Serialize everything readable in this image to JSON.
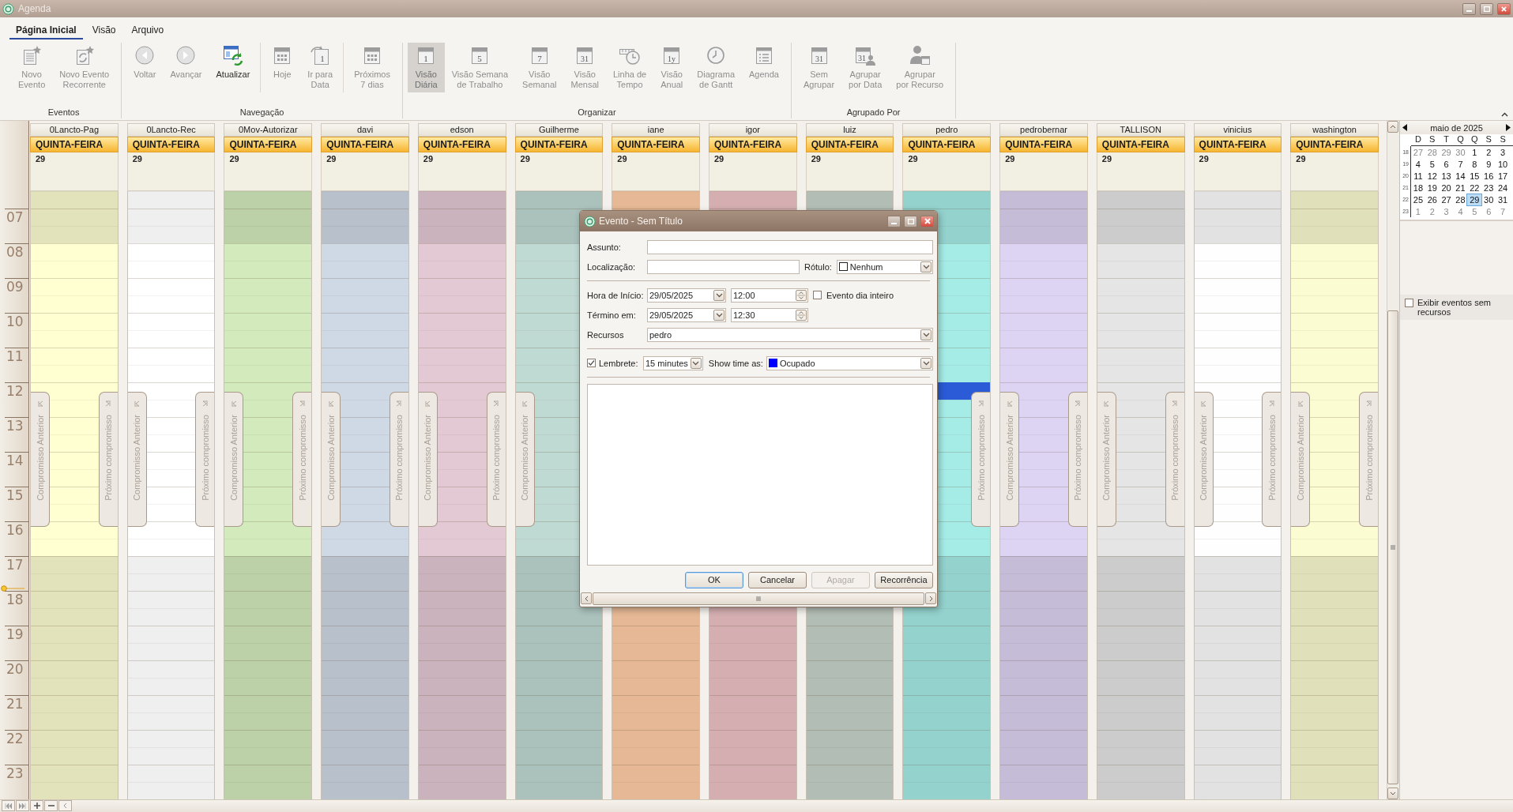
{
  "window": {
    "title": "Agenda"
  },
  "ribbon": {
    "tabs": [
      {
        "label": "Página Inicial",
        "selected": true
      },
      {
        "label": "Visão",
        "selected": false
      },
      {
        "label": "Arquivo",
        "selected": false
      }
    ],
    "groups": [
      {
        "label": "Eventos",
        "sections": [
          [
            {
              "label": "Novo\nEvento",
              "kind": "new-doc",
              "disabled": true,
              "selected": false
            },
            {
              "label": "Novo Evento\nRecorrente",
              "kind": "recur-doc",
              "disabled": true,
              "selected": false
            }
          ]
        ]
      },
      {
        "label": "Navegação",
        "sections": [
          [
            {
              "label": "Voltar",
              "kind": "back",
              "disabled": true,
              "selected": false
            },
            {
              "label": "Avançar",
              "kind": "forward",
              "disabled": true,
              "selected": false
            },
            {
              "label": "Atualizar",
              "kind": "refresh",
              "disabled": false,
              "selected": false
            }
          ],
          [
            {
              "label": "Hoje",
              "kind": "grid-cal",
              "disabled": true,
              "selected": false
            },
            {
              "label": "Ir para\nData",
              "kind": "page-arrow",
              "icon_text": "1",
              "disabled": true,
              "selected": false
            }
          ],
          [
            {
              "label": "Próximos\n7 dias",
              "kind": "grid-cal",
              "disabled": true,
              "selected": false
            }
          ]
        ]
      },
      {
        "label": "Organizar",
        "sections": [
          [
            {
              "label": "Visão\nDiária",
              "kind": "calendar",
              "icon_text": "1",
              "disabled": true,
              "selected": true
            },
            {
              "label": "Visão Semana\nde Trabalho",
              "kind": "calendar",
              "icon_text": "5",
              "disabled": true,
              "selected": false
            },
            {
              "label": "Visão\nSemanal",
              "kind": "calendar",
              "icon_text": "7",
              "disabled": true,
              "selected": false
            },
            {
              "label": "Visão\nMensal",
              "kind": "calendar",
              "icon_text": "31",
              "disabled": true,
              "selected": false
            },
            {
              "label": "Linha de\nTempo",
              "kind": "timeline",
              "disabled": true,
              "selected": false
            },
            {
              "label": "Visão\nAnual",
              "kind": "calendar",
              "icon_text": "1y",
              "disabled": true,
              "selected": false
            },
            {
              "label": "Diagrama\nde Gantt",
              "kind": "clock",
              "disabled": true,
              "selected": false
            },
            {
              "label": "Agenda",
              "kind": "list",
              "disabled": true,
              "selected": false
            }
          ]
        ]
      },
      {
        "label": "Agrupado Por",
        "sections": [
          [
            {
              "label": "Sem\nAgrupar",
              "kind": "calendar",
              "icon_text": "31",
              "disabled": true,
              "selected": false
            },
            {
              "label": "Agrupar\npor Data",
              "kind": "cal-person",
              "icon_text": "31",
              "disabled": true,
              "selected": false
            },
            {
              "label": "Agrupar\npor Recurso",
              "kind": "person-cal",
              "disabled": true,
              "selected": false
            }
          ]
        ]
      }
    ]
  },
  "time_labels": [
    "07",
    "08",
    "09",
    "10",
    "11",
    "12",
    "13",
    "14",
    "15",
    "16",
    "17",
    "18",
    "19",
    "20",
    "21",
    "22",
    "23"
  ],
  "columns": [
    {
      "name": "0Lancto-Pag",
      "day": "QUINTA-FEIRA",
      "date": "29",
      "color": "#e3e3bb",
      "prev_tab": "Compromisso Anterior",
      "next_tab": "Próximo compromisso",
      "slot_selected": false
    },
    {
      "name": "0Lancto-Rec",
      "day": "QUINTA-FEIRA",
      "date": "29",
      "color": "#efefef",
      "prev_tab": "Compromisso Anterior",
      "next_tab": "Próximo compromisso",
      "slot_selected": false
    },
    {
      "name": "0Mov-Autorizar",
      "day": "QUINTA-FEIRA",
      "date": "29",
      "color": "#bcd1a7",
      "prev_tab": "Compromisso Anterior",
      "next_tab": "Próximo compromisso",
      "slot_selected": false
    },
    {
      "name": "davi",
      "day": "QUINTA-FEIRA",
      "date": "29",
      "color": "#b8c0cc",
      "prev_tab": "Compromisso Anterior",
      "next_tab": "Próximo compromisso",
      "slot_selected": false
    },
    {
      "name": "edson",
      "day": "QUINTA-FEIRA",
      "date": "29",
      "color": "#cab3bc",
      "prev_tab": "Compromisso Anterior",
      "next_tab": "Próximo compromisso",
      "slot_selected": false
    },
    {
      "name": "Guilherme",
      "day": "QUINTA-FEIRA",
      "date": "29",
      "color": "#aac1bc",
      "prev_tab": "Compromisso Anterior",
      "slot_selected": false
    },
    {
      "name": "iane",
      "day": "QUINTA-FEIRA",
      "date": "29",
      "color": "#e6b895",
      "slot_selected": false
    },
    {
      "name": "igor",
      "day": "QUINTA-FEIRA",
      "date": "29",
      "color": "#d4aeb1",
      "slot_selected": false
    },
    {
      "name": "luiz",
      "day": "QUINTA-FEIRA",
      "date": "29",
      "color": "#b2bdb5",
      "slot_selected": false
    },
    {
      "name": "pedro",
      "day": "QUINTA-FEIRA",
      "date": "29",
      "color": "#94d2cd",
      "next_tab": "Próximo compromisso",
      "slot_selected": true
    },
    {
      "name": "pedrobernar",
      "day": "QUINTA-FEIRA",
      "date": "29",
      "color": "#c5bdd8",
      "prev_tab": "Compromisso Anterior",
      "next_tab": "Próximo compromisso",
      "slot_selected": false
    },
    {
      "name": "TALLISON",
      "day": "QUINTA-FEIRA",
      "date": "29",
      "color": "#cccccc",
      "prev_tab": "Compromisso Anterior",
      "next_tab": "Próximo compromisso",
      "slot_selected": false
    },
    {
      "name": "vinicius",
      "day": "QUINTA-FEIRA",
      "date": "29",
      "color": "#e2e2e2",
      "prev_tab": "Compromisso Anterior",
      "next_tab": "Próximo compromisso",
      "slot_selected": false
    },
    {
      "name": "washington",
      "day": "QUINTA-FEIRA",
      "date": "29",
      "color": "#e0e0bb",
      "prev_tab": "Compromisso Anterior",
      "next_tab": "Próximo compromisso",
      "slot_selected": false
    }
  ],
  "mini_calendar": {
    "title": "maio de 2025",
    "weekdays": [
      "D",
      "S",
      "T",
      "Q",
      "Q",
      "S",
      "S"
    ],
    "weeks": [
      {
        "number": "18",
        "days": [
          {
            "d": "27",
            "other": true,
            "selected": false
          },
          {
            "d": "28",
            "other": true,
            "selected": false
          },
          {
            "d": "29",
            "other": true,
            "selected": false
          },
          {
            "d": "30",
            "other": true,
            "selected": false
          },
          {
            "d": "1",
            "other": false,
            "selected": false
          },
          {
            "d": "2",
            "other": false,
            "selected": false
          },
          {
            "d": "3",
            "other": false,
            "selected": false
          }
        ]
      },
      {
        "number": "19",
        "days": [
          {
            "d": "4",
            "other": false,
            "selected": false
          },
          {
            "d": "5",
            "other": false,
            "selected": false
          },
          {
            "d": "6",
            "other": false,
            "selected": false
          },
          {
            "d": "7",
            "other": false,
            "selected": false
          },
          {
            "d": "8",
            "other": false,
            "selected": false
          },
          {
            "d": "9",
            "other": false,
            "selected": false
          },
          {
            "d": "10",
            "other": false,
            "selected": false
          }
        ]
      },
      {
        "number": "20",
        "days": [
          {
            "d": "11",
            "other": false,
            "selected": false
          },
          {
            "d": "12",
            "other": false,
            "selected": false
          },
          {
            "d": "13",
            "other": false,
            "selected": false
          },
          {
            "d": "14",
            "other": false,
            "selected": false
          },
          {
            "d": "15",
            "other": false,
            "selected": false
          },
          {
            "d": "16",
            "other": false,
            "selected": false
          },
          {
            "d": "17",
            "other": false,
            "selected": false
          }
        ]
      },
      {
        "number": "21",
        "days": [
          {
            "d": "18",
            "other": false,
            "selected": false
          },
          {
            "d": "19",
            "other": false,
            "selected": false
          },
          {
            "d": "20",
            "other": false,
            "selected": false
          },
          {
            "d": "21",
            "other": false,
            "selected": false
          },
          {
            "d": "22",
            "other": false,
            "selected": false
          },
          {
            "d": "23",
            "other": false,
            "selected": false
          },
          {
            "d": "24",
            "other": false,
            "selected": false
          }
        ]
      },
      {
        "number": "22",
        "days": [
          {
            "d": "25",
            "other": false,
            "selected": false
          },
          {
            "d": "26",
            "other": false,
            "selected": false
          },
          {
            "d": "27",
            "other": false,
            "selected": false
          },
          {
            "d": "28",
            "other": false,
            "selected": false
          },
          {
            "d": "29",
            "other": false,
            "selected": true
          },
          {
            "d": "30",
            "other": false,
            "selected": false
          },
          {
            "d": "31",
            "other": false,
            "selected": false
          }
        ]
      },
      {
        "number": "23",
        "days": [
          {
            "d": "1",
            "other": true,
            "selected": false
          },
          {
            "d": "2",
            "other": true,
            "selected": false
          },
          {
            "d": "3",
            "other": true,
            "selected": false
          },
          {
            "d": "4",
            "other": true,
            "selected": false
          },
          {
            "d": "5",
            "other": true,
            "selected": false
          },
          {
            "d": "6",
            "other": true,
            "selected": false
          },
          {
            "d": "7",
            "other": true,
            "selected": false
          }
        ]
      }
    ]
  },
  "unassigned_option": {
    "label": "Exibir eventos sem recursos",
    "checked": false
  },
  "dialog": {
    "title": "Evento - Sem Título",
    "subject": {
      "label": "Assunto:"
    },
    "location": {
      "label": "Localização:"
    },
    "label_field": {
      "label": "Rótulo:",
      "value": "Nenhum"
    },
    "start": {
      "label": "Hora de Início:",
      "date": "29/05/2025",
      "time": "12:00"
    },
    "all_day": {
      "label": "Evento dia inteiro",
      "checked": false
    },
    "end": {
      "label": "Término em:",
      "date": "29/05/2025",
      "time": "12:30"
    },
    "resources": {
      "label": "Recursos",
      "value": "pedro"
    },
    "reminder": {
      "label": "Lembrete:",
      "checked": true,
      "value": "15 minutes"
    },
    "show_time_as": {
      "label": "Show time as:",
      "value": "Ocupado",
      "color": "#0000ff"
    },
    "buttons": [
      {
        "label": "OK",
        "default": true,
        "disabled": false
      },
      {
        "label": "Cancelar",
        "default": false,
        "disabled": false
      },
      {
        "label": "Apagar",
        "default": false,
        "disabled": true
      },
      {
        "label": "Recorrência",
        "default": false,
        "disabled": false
      }
    ]
  }
}
